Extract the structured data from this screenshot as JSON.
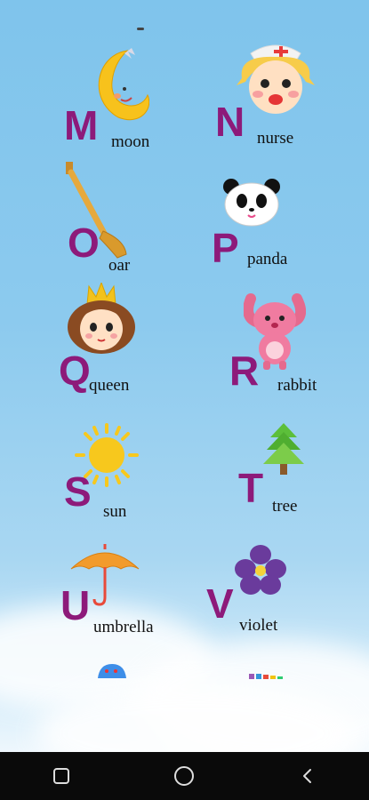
{
  "items": [
    {
      "letter": "M",
      "word": "moon",
      "icon": "moon-icon"
    },
    {
      "letter": "N",
      "word": "nurse",
      "icon": "nurse-icon"
    },
    {
      "letter": "O",
      "word": "oar",
      "icon": "oar-icon"
    },
    {
      "letter": "P",
      "word": "panda",
      "icon": "panda-icon"
    },
    {
      "letter": "Q",
      "word": "queen",
      "icon": "queen-icon"
    },
    {
      "letter": "R",
      "word": "rabbit",
      "icon": "rabbit-icon"
    },
    {
      "letter": "S",
      "word": "sun",
      "icon": "sun-icon"
    },
    {
      "letter": "T",
      "word": "tree",
      "icon": "tree-icon"
    },
    {
      "letter": "U",
      "word": "umbrella",
      "icon": "umbrella-icon"
    },
    {
      "letter": "V",
      "word": "violet",
      "icon": "violet-icon"
    }
  ],
  "colors": {
    "letter": "#8d1a7a",
    "sky": "#7fc4ec",
    "navbar": "#0a0a0a"
  },
  "navbar": {
    "buttons": [
      "recent-apps-icon",
      "home-icon",
      "back-icon"
    ]
  }
}
